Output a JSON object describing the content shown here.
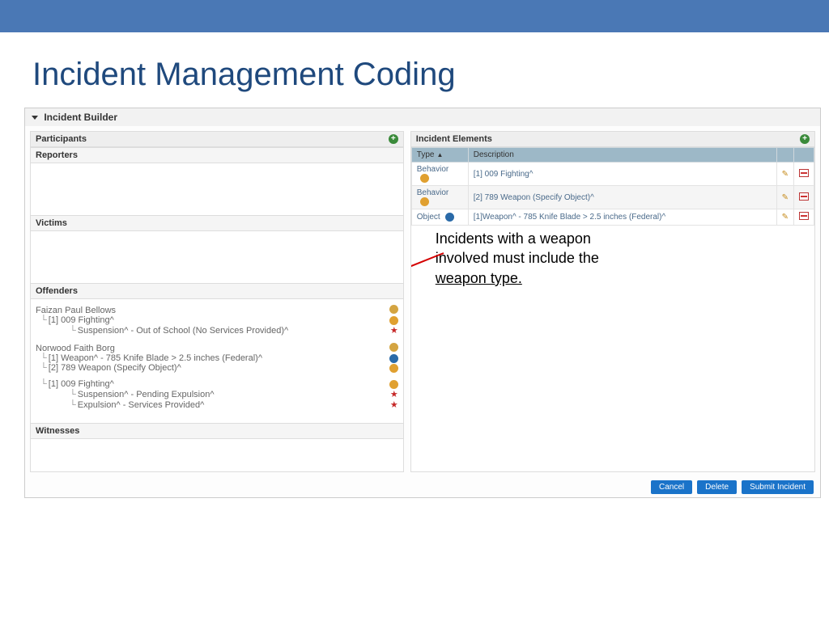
{
  "title": "Incident Management Coding",
  "builder_header": "Incident Builder",
  "participants": {
    "title": "Participants",
    "reporters": "Reporters",
    "victims": "Victims",
    "offenders": "Offenders",
    "witnesses": "Witnesses"
  },
  "offenders": [
    {
      "name": "Faizan Paul Bellows",
      "icon": "person",
      "lines": [
        {
          "text": "[1] 009 Fighting^",
          "icon": "hand",
          "sub": [
            {
              "text": "Suspension^ - Out of School (No Services Provided)^",
              "star": true
            }
          ]
        }
      ]
    },
    {
      "name": "Norwood Faith Borg",
      "icon": "person",
      "lines": [
        {
          "text": "[1] Weapon^ - 785 Knife Blade > 2.5 inches (Federal)^",
          "icon": "cube"
        },
        {
          "text": "[2] 789 Weapon (Specify Object)^",
          "icon": "hand"
        },
        {
          "text": "[1] 009 Fighting^",
          "icon": "hand",
          "sub": [
            {
              "text": "Suspension^ - Pending Expulsion^",
              "star": true
            },
            {
              "text": "Expulsion^ - Services Provided^",
              "star": true
            }
          ]
        }
      ],
      "line_gap_index": 2
    }
  ],
  "elements": {
    "title": "Incident Elements",
    "cols": {
      "type": "Type",
      "desc": "Description"
    },
    "rows": [
      {
        "type": "Behavior",
        "icon": "hand",
        "desc": "[1] 009 Fighting^"
      },
      {
        "type": "Behavior",
        "icon": "hand",
        "desc": "[2] 789 Weapon (Specify Object)^"
      },
      {
        "type": "Object",
        "icon": "cube",
        "desc": "[1]Weapon^ - 785 Knife Blade > 2.5 inches (Federal)^"
      }
    ]
  },
  "note": {
    "line1": "Incidents with a weapon",
    "line2": "involved must include the",
    "line3_u": "weapon type."
  },
  "buttons": {
    "cancel": "Cancel",
    "delete": "Delete",
    "submit": "Submit Incident"
  }
}
